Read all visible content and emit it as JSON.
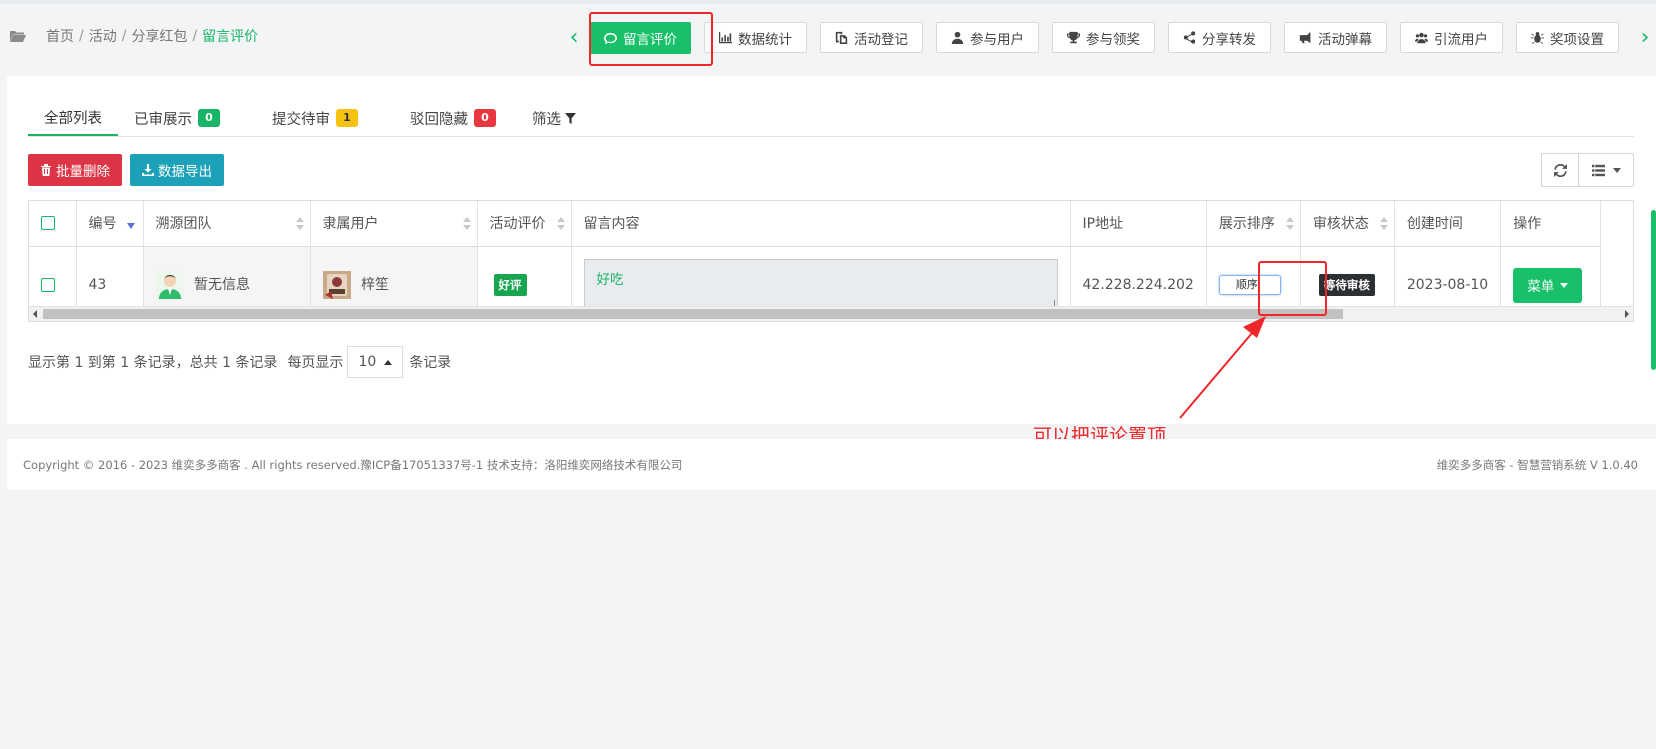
{
  "breadcrumb": {
    "home": "首页",
    "activity": "活动",
    "share": "分享红包",
    "current": "留言评价",
    "separator": "/"
  },
  "nav": {
    "buttons": [
      {
        "label": "留言评价",
        "icon": "comment-icon"
      },
      {
        "label": "数据统计",
        "icon": "bar-chart-icon"
      },
      {
        "label": "活动登记",
        "icon": "copy-icon"
      },
      {
        "label": "参与用户",
        "icon": "user-icon"
      },
      {
        "label": "参与领奖",
        "icon": "trophy-icon"
      },
      {
        "label": "分享转发",
        "icon": "share-icon"
      },
      {
        "label": "活动弹幕",
        "icon": "bullhorn-icon"
      },
      {
        "label": "引流用户",
        "icon": "users-icon"
      },
      {
        "label": "奖项设置",
        "icon": "bug-icon"
      }
    ]
  },
  "tabs": {
    "all": "全部列表",
    "approved": "已审展示",
    "approved_count": "0",
    "pending": "提交待审",
    "pending_count": "1",
    "rejected": "驳回隐藏",
    "rejected_count": "0",
    "filter": "筛选"
  },
  "toolbar": {
    "delete": "批量删除",
    "export": "数据导出"
  },
  "table": {
    "headers": {
      "id": "编号",
      "team": "溯源团队",
      "user": "隶属用户",
      "rating": "活动评价",
      "content": "留言内容",
      "ip": "IP地址",
      "order": "展示排序",
      "status": "审核状态",
      "created": "创建时间",
      "action": "操作"
    },
    "rows": [
      {
        "id": "43",
        "team": "暂无信息",
        "user": "梓笙",
        "rating": "好评",
        "content": "好吃",
        "ip": "42.228.224.202",
        "order": "顺序",
        "status": "等待审核",
        "created": "2023-08-10",
        "action": "菜单"
      }
    ]
  },
  "pagination": {
    "summary": "显示第 1 到第 1 条记录，总共 1 条记录",
    "per_page_label": "每页显示",
    "per_page": "10",
    "suffix": "条记录"
  },
  "annotation": {
    "text": "可以把评论置顶",
    "color": "#f0272a"
  },
  "footer": {
    "left": "Copyright © 2016 - 2023 维奕多多商客 . All rights reserved.豫ICP备17051337号-1 技术支持：洛阳维奕网络技术有限公司",
    "right": "维奕多多商客 - 智慧营销系统 V 1.0.40"
  },
  "colors": {
    "accent": "#18c06a",
    "danger": "#dc3546",
    "info": "#1da1b8",
    "warning": "#f7c210"
  }
}
